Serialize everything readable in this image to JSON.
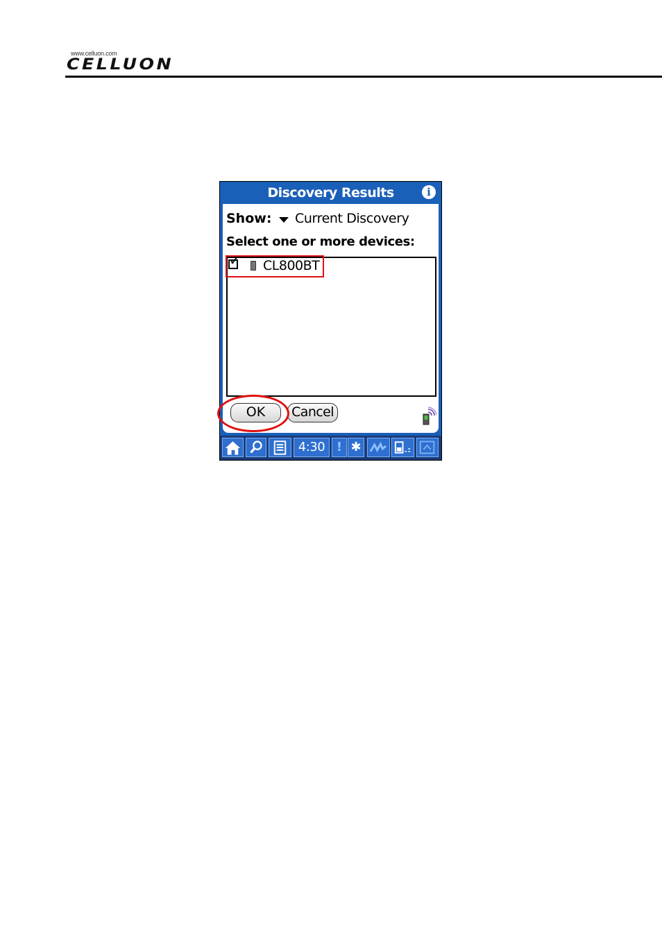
{
  "header": {
    "logo_url_text": "www.celluon.com",
    "logo_word": "CELLUON"
  },
  "dialog": {
    "title": "Discovery Results",
    "info_icon_glyph": "i",
    "show_label": "Show:",
    "show_value": "Current Discovery",
    "select_label": "Select one or more devices:",
    "devices": [
      {
        "name": "CL800BT",
        "checked": true,
        "icon": "phone-icon"
      }
    ],
    "ok_label": "OK",
    "cancel_label": "Cancel"
  },
  "status_bar": {
    "time": "4:30",
    "alert_glyph": "!",
    "bluetooth_glyph": "✱"
  },
  "colors": {
    "title_bar": "#1a5fb8",
    "highlight": "#e01010",
    "status_bar": "#1a3b7a"
  }
}
